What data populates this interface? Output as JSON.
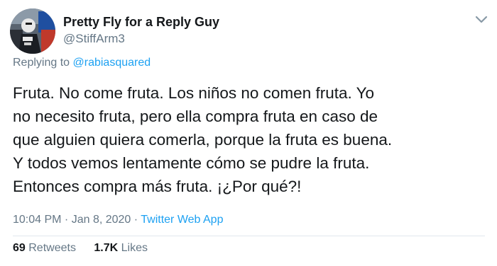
{
  "author": {
    "display_name": "Pretty Fly for a Reply Guy",
    "handle": "@StiffArm3",
    "avatar_icon": "profile-photo-icon"
  },
  "more_icon": "chevron-down-icon",
  "reply": {
    "prefix": "Replying to",
    "mention": "@rabiasquared"
  },
  "tweet": {
    "lines": [
      "Fruta. No come fruta. Los niños no comen fruta. Yo",
      "no necesito fruta, pero ella compra fruta en caso de",
      "que alguien quiera comerla, porque la fruta es buena.",
      "Y todos vemos lentamente cómo se pudre la fruta.",
      "Entonces compra más fruta. ¡¿Por qué?!"
    ]
  },
  "meta": {
    "time": "10:04 PM",
    "separator1": " · ",
    "date": "Jan 8, 2020",
    "separator2": " · ",
    "app": "Twitter Web App"
  },
  "stats": {
    "retweets_count": "69",
    "retweets_label": "Retweets",
    "likes_count": "1.7K",
    "likes_label": "Likes"
  },
  "colors": {
    "text": "#14171a",
    "secondary": "#657786",
    "accent": "#1da1f2",
    "divider": "#e1e8ed"
  }
}
